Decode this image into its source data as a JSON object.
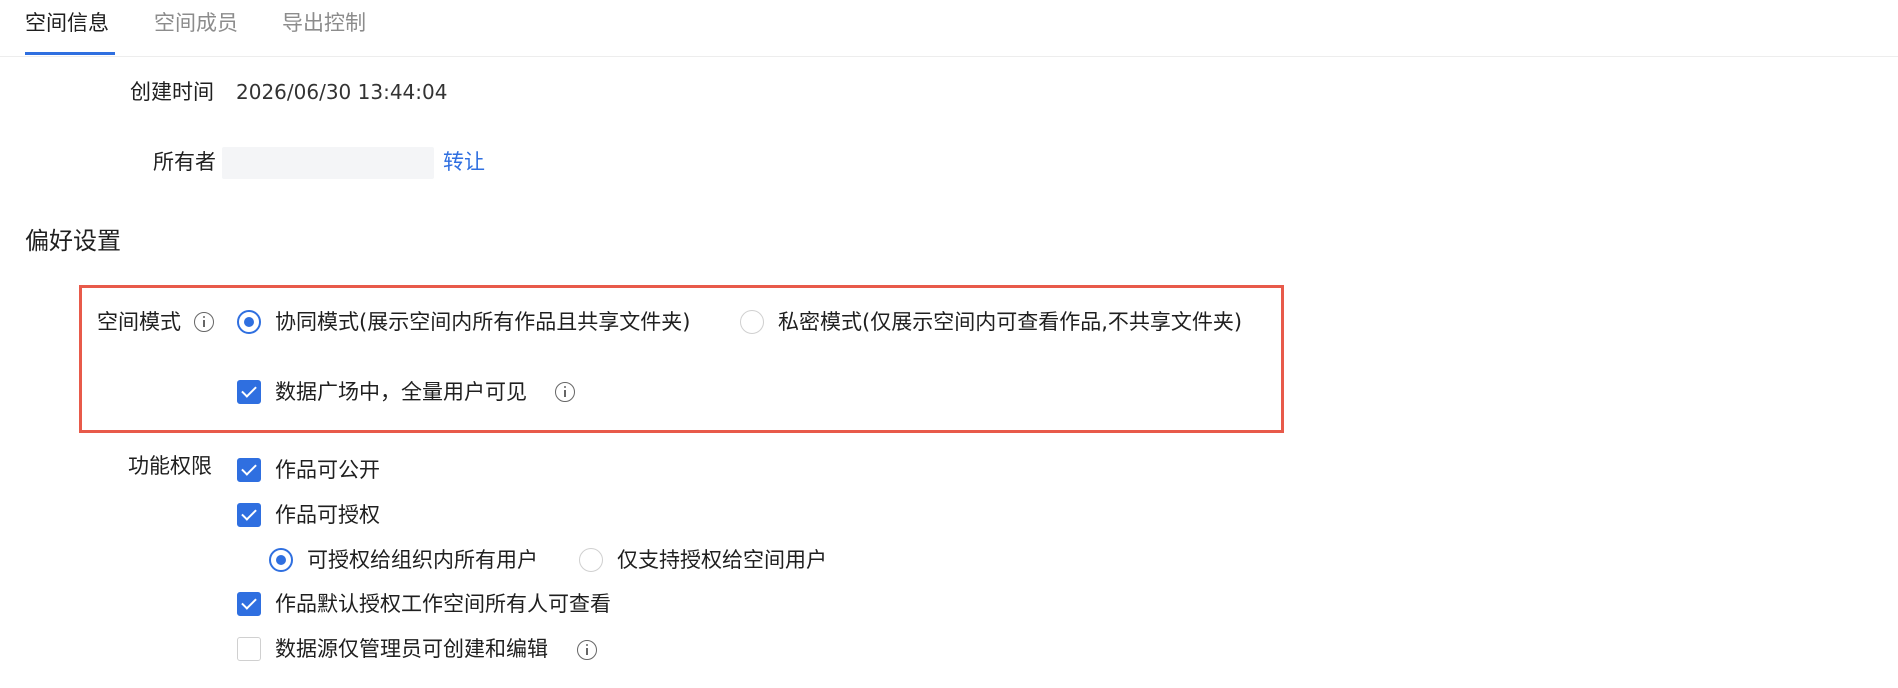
{
  "tabs": [
    {
      "label": "空间信息",
      "active": true
    },
    {
      "label": "空间成员",
      "active": false
    },
    {
      "label": "导出控制",
      "active": false
    }
  ],
  "info": {
    "created_label": "创建时间",
    "created_value": "2026/06/30 13:44:04",
    "owner_label": "所有者",
    "transfer_link": "转让"
  },
  "prefs": {
    "title": "偏好设置",
    "space_mode_label": "空间模式",
    "mode_collab": "协同模式(展示空间内所有作品且共享文件夹)",
    "mode_private": "私密模式(仅展示空间内可查看作品,不共享文件夹)",
    "data_square": "数据广场中，全量用户可见"
  },
  "permissions": {
    "label": "功能权限",
    "public": "作品可公开",
    "authorize": "作品可授权",
    "auth_org": "可授权给组织内所有用户",
    "auth_space": "仅支持授权给空间用户",
    "default_view": "作品默认授权工作空间所有人可查看",
    "datasource_admin": "数据源仅管理员可创建和编辑"
  },
  "state": {
    "space_mode": "collab",
    "data_square_checked": true,
    "public_checked": true,
    "authorize_checked": true,
    "auth_scope": "org",
    "default_view_checked": true,
    "datasource_admin_checked": false
  },
  "colors": {
    "accent": "#2f6fe0",
    "highlight_border": "#e85a4a"
  }
}
